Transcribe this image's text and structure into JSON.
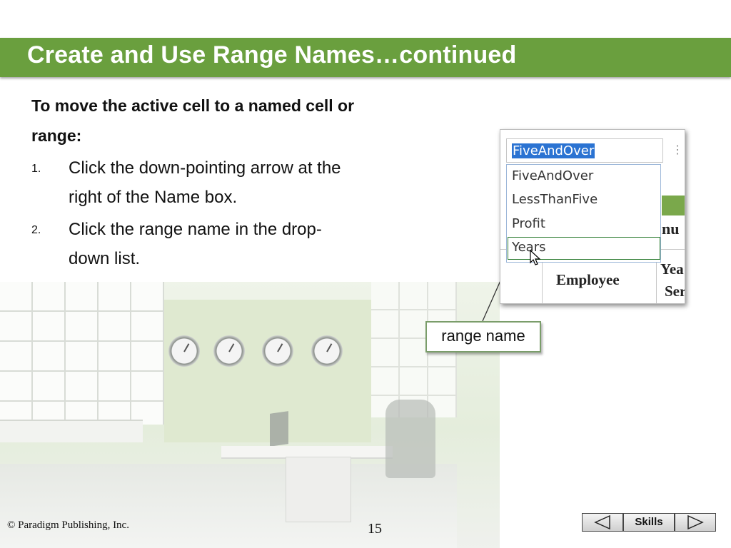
{
  "slide": {
    "title": "Create and Use Range Names…continued",
    "accent_color": "#6a9f3e"
  },
  "content": {
    "lead": "To move the active cell to a named cell or range:",
    "steps": [
      {
        "num": "1.",
        "text": "Click the down-pointing arrow at the right of the Name box."
      },
      {
        "num": "2.",
        "text": "Click the range name in the drop-down list."
      }
    ]
  },
  "screenshot": {
    "name_box_value": "FiveAndOver",
    "options_icon": "vertical-dots-icon",
    "dropdown_items": [
      "FiveAndOver",
      "LessThanFive",
      "Profit",
      "Years"
    ],
    "selected_item": "Years",
    "sheet_header_fragment": "nu",
    "employee_header": "Employee",
    "year_header_top": "Yea",
    "year_header_bottom": "Ser"
  },
  "callout": {
    "label": "range name"
  },
  "footer": {
    "copyright": "© Paradigm Publishing, Inc.",
    "page_number": "15",
    "nav": {
      "prev_icon": "left-triangle-icon",
      "skills_label": "Skills",
      "next_icon": "right-triangle-icon"
    }
  }
}
